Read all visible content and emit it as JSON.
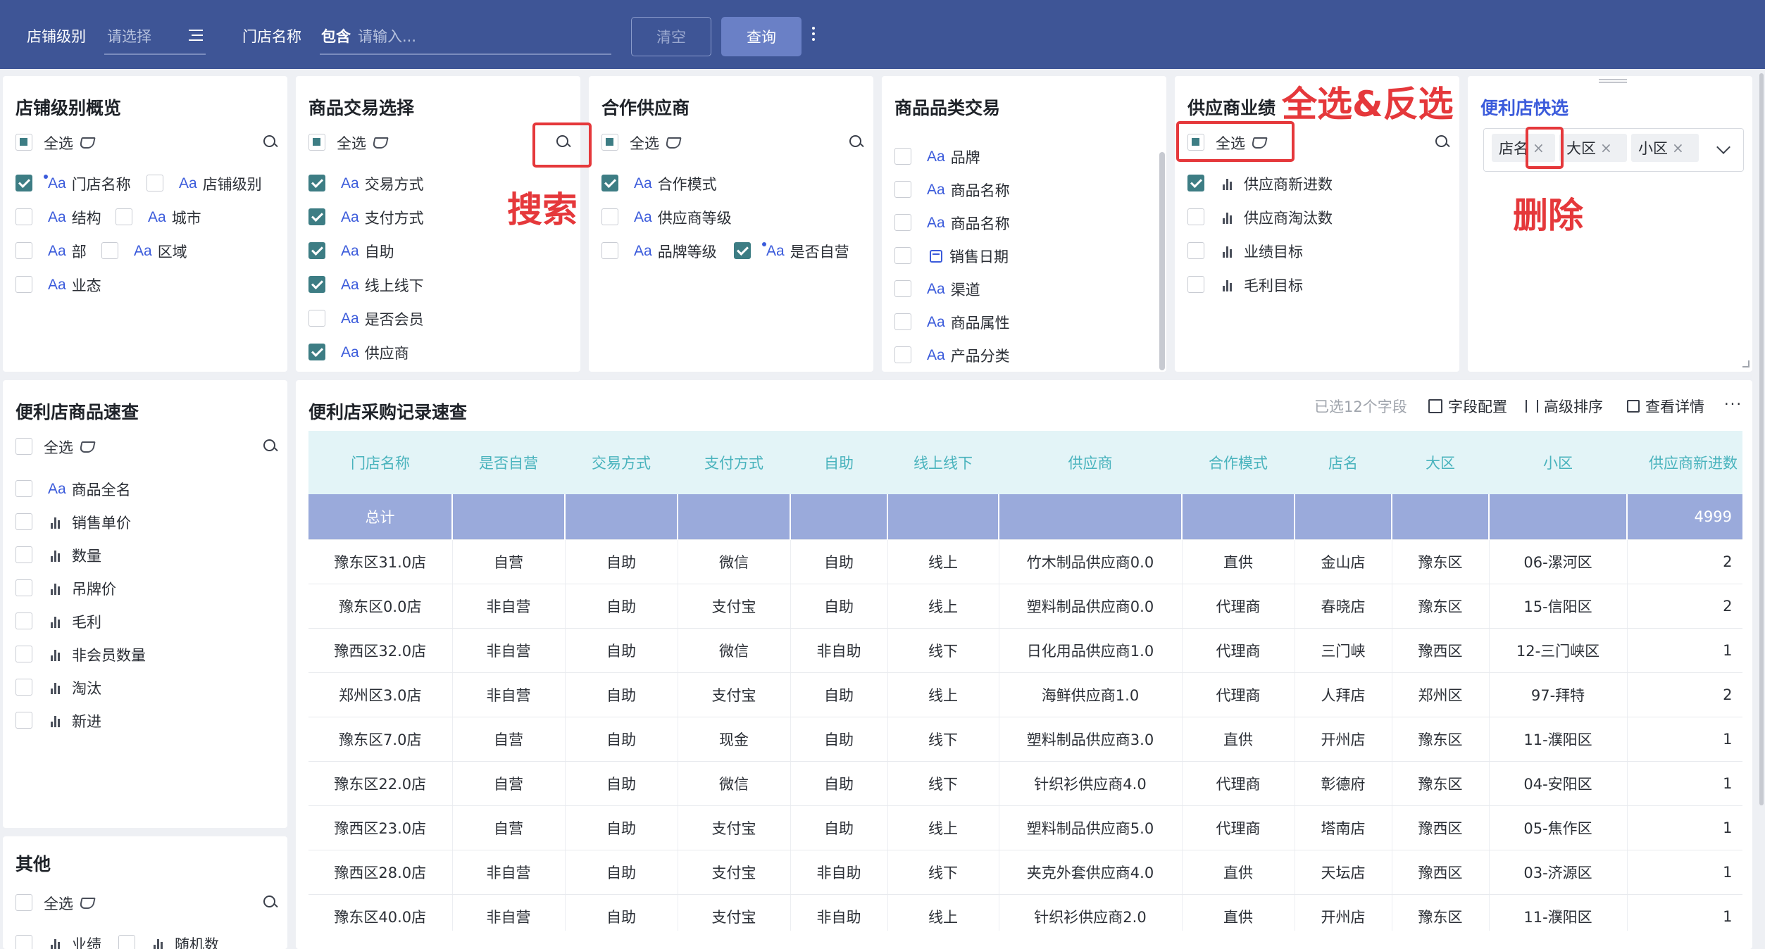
{
  "topbar": {
    "store_level_label": "店铺级别",
    "store_level_placeholder": "请选择",
    "store_name_label": "门店名称",
    "store_name_mode": "包含",
    "store_name_placeholder": "请输入...",
    "clear_label": "清空",
    "query_label": "查询"
  },
  "common": {
    "select_all": "全选"
  },
  "panels": {
    "store_level": {
      "title": "店铺级别概览",
      "fields": [
        {
          "label": "门店名称",
          "checked": true
        },
        {
          "label": "店铺级别",
          "checked": false
        },
        {
          "label": "结构",
          "checked": false
        },
        {
          "label": "城市",
          "checked": false
        },
        {
          "label": "部",
          "checked": false
        },
        {
          "label": "区域",
          "checked": false
        },
        {
          "label": "业态",
          "checked": false
        }
      ]
    },
    "trade_select": {
      "title": "商品交易选择",
      "fields": [
        "交易方式",
        "支付方式",
        "自助",
        "线上线下",
        "是否会员",
        "供应商"
      ]
    },
    "partner_supplier": {
      "title": "合作供应商",
      "fields": [
        "合作模式",
        "供应商等级",
        "品牌等级",
        "是否自营"
      ]
    },
    "category_trade": {
      "title": "商品品类交易",
      "fields": [
        "品牌",
        "商品名称",
        "商品名称",
        "销售日期",
        "渠道",
        "商品属性",
        "产品分类"
      ]
    },
    "supplier_perf": {
      "title": "供应商业绩",
      "fields": [
        "供应商新进数",
        "供应商淘汰数",
        "业绩目标",
        "毛利目标"
      ]
    },
    "quick_select": {
      "title": "便利店快选",
      "tags": [
        "店名",
        "大区",
        "小区"
      ]
    },
    "product_lookup": {
      "title": "便利店商品速查",
      "fields": [
        "商品全名",
        "销售单价",
        "数量",
        "吊牌价",
        "毛利",
        "非会员数量",
        "淘汰",
        "新进"
      ]
    },
    "other": {
      "title": "其他",
      "fields": [
        "业绩",
        "随机数"
      ]
    }
  },
  "annotations": {
    "select_invert": "全选&反选",
    "search": "搜索",
    "delete": "删除"
  },
  "table": {
    "title": "便利店采购记录速查",
    "selected_count": "已选12个字段",
    "field_config": "字段配置",
    "advanced_sort": "高级排序",
    "view_details": "查看详情",
    "columns": [
      "门店名称",
      "是否自营",
      "交易方式",
      "支付方式",
      "自助",
      "线上线下",
      "供应商",
      "合作模式",
      "店名",
      "大区",
      "小区",
      "供应商新进数"
    ],
    "total_label": "总计",
    "total_value": "4999",
    "rows": [
      [
        "豫东区31.0店",
        "自营",
        "自助",
        "微信",
        "自助",
        "线上",
        "竹木制品供应商0.0",
        "直供",
        "金山店",
        "豫东区",
        "06-漯河区",
        "2"
      ],
      [
        "豫东区0.0店",
        "非自营",
        "自助",
        "支付宝",
        "自助",
        "线上",
        "塑料制品供应商0.0",
        "代理商",
        "春晓店",
        "豫东区",
        "15-信阳区",
        "2"
      ],
      [
        "豫西区32.0店",
        "非自营",
        "自助",
        "微信",
        "非自助",
        "线下",
        "日化用品供应商1.0",
        "代理商",
        "三门峡",
        "豫西区",
        "12-三门峡区",
        "1"
      ],
      [
        "郑州区3.0店",
        "非自营",
        "自助",
        "支付宝",
        "自助",
        "线上",
        "海鲜供应商1.0",
        "代理商",
        "人拜店",
        "郑州区",
        "97-拜特",
        "2"
      ],
      [
        "豫东区7.0店",
        "自营",
        "自助",
        "现金",
        "自助",
        "线下",
        "塑料制品供应商3.0",
        "直供",
        "开州店",
        "豫东区",
        "11-濮阳区",
        "1"
      ],
      [
        "豫东区22.0店",
        "自营",
        "自助",
        "微信",
        "自助",
        "线下",
        "针织衫供应商4.0",
        "代理商",
        "彰德府",
        "豫东区",
        "04-安阳区",
        "1"
      ],
      [
        "豫西区23.0店",
        "自营",
        "自助",
        "支付宝",
        "自助",
        "线上",
        "塑料制品供应商5.0",
        "代理商",
        "塔南店",
        "豫西区",
        "05-焦作区",
        "1"
      ],
      [
        "豫西区28.0店",
        "非自营",
        "自助",
        "支付宝",
        "非自助",
        "线下",
        "夹克外套供应商4.0",
        "直供",
        "天坛店",
        "豫西区",
        "03-济源区",
        "1"
      ],
      [
        "豫东区40.0店",
        "非自营",
        "自助",
        "支付宝",
        "非自助",
        "线上",
        "针织衫供应商2.0",
        "直供",
        "开州店",
        "豫东区",
        "11-濮阳区",
        "1"
      ]
    ]
  },
  "colors": {
    "topbar": "#3e5596",
    "accent": "#3b5bdb",
    "check": "#3d7d84",
    "header_text": "#49b3bd",
    "total_row": "#9aaadb",
    "annotation": "#e5383b"
  }
}
